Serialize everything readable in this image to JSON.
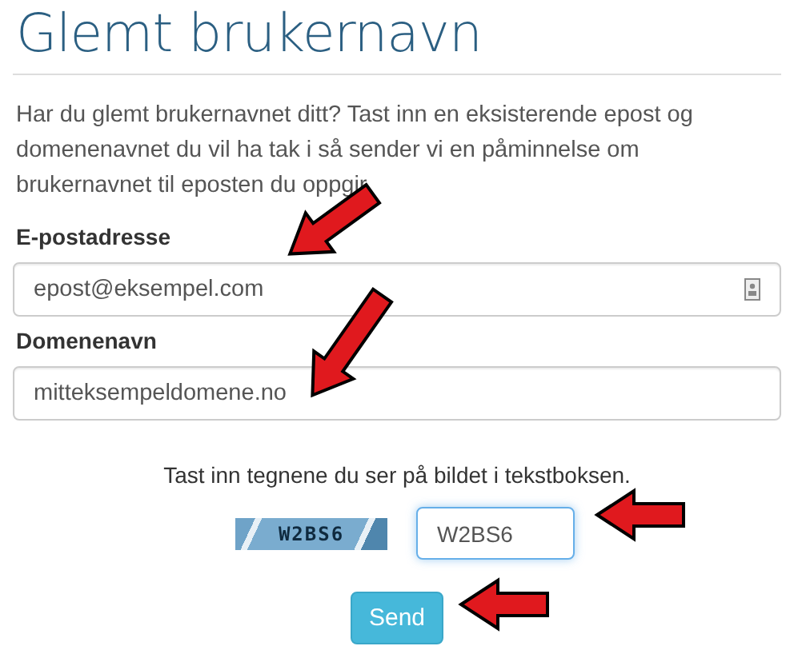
{
  "title": "Glemt brukernavn",
  "intro": "Har du glemt brukernavnet ditt? Tast inn en eksisterende epost og domenenavnet du vil ha tak i så sender vi en påminnelse om brukernavnet til eposten du oppgir.",
  "fields": [
    {
      "label": "E-postadresse",
      "value": "epost@eksempel.com",
      "icon": true
    },
    {
      "label": "Domenenavn",
      "value": "mitteksempeldomene.no"
    }
  ],
  "captcha": {
    "instruction": "Tast inn tegnene du ser på bildet i tekstboksen.",
    "image_text": "W2BS6",
    "value": "W2BS6",
    "focused": true
  },
  "submit": "Send"
}
